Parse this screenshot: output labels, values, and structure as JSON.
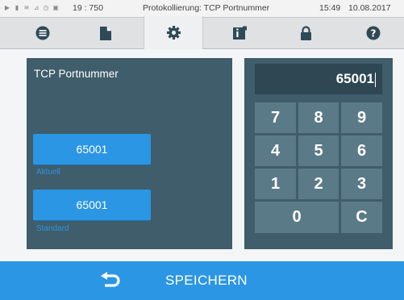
{
  "status_bar": {
    "time_short": "19 : 750",
    "title": "Protokollierung: TCP Portnummer",
    "time": "15:49",
    "date": "10.08.2017"
  },
  "tabs": [
    {
      "icon": "list-icon",
      "active": false
    },
    {
      "icon": "document-icon",
      "active": false
    },
    {
      "icon": "gear-icon",
      "active": true
    },
    {
      "icon": "info-book-icon",
      "active": false
    },
    {
      "icon": "lock-icon",
      "active": false
    },
    {
      "icon": "help-icon",
      "active": false
    }
  ],
  "left_panel": {
    "title": "TCP Portnummer",
    "current_value": "65001",
    "current_label": "Aktuell",
    "default_value": "65001",
    "default_label": "Standard"
  },
  "keypad": {
    "display_value": "65001",
    "keys": [
      "7",
      "8",
      "9",
      "4",
      "5",
      "6",
      "1",
      "2",
      "3",
      "0",
      "C"
    ]
  },
  "bottom_bar": {
    "save_label": "SPEICHERN"
  },
  "colors": {
    "accent": "#2b96e4",
    "panel": "#3f5d6b",
    "key": "#5b7a88",
    "icon": "#2f4a57"
  }
}
